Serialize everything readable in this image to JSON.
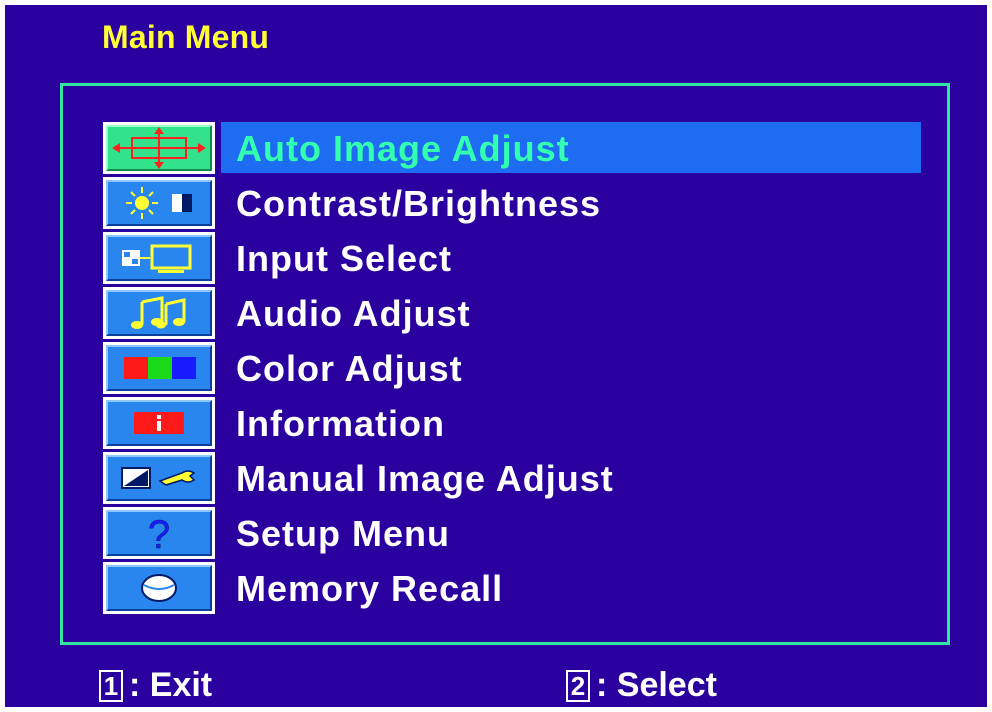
{
  "title": "Main Menu",
  "menu": {
    "items": [
      {
        "label": "Auto Image Adjust",
        "icon": "auto-adjust-icon",
        "selected": true
      },
      {
        "label": "Contrast/Brightness",
        "icon": "contrast-brightness-icon",
        "selected": false
      },
      {
        "label": "Input Select",
        "icon": "input-select-icon",
        "selected": false
      },
      {
        "label": "Audio Adjust",
        "icon": "audio-icon",
        "selected": false
      },
      {
        "label": "Color Adjust",
        "icon": "color-adjust-icon",
        "selected": false
      },
      {
        "label": "Information",
        "icon": "information-icon",
        "selected": false
      },
      {
        "label": "Manual Image Adjust",
        "icon": "manual-adjust-icon",
        "selected": false
      },
      {
        "label": "Setup Menu",
        "icon": "setup-menu-icon",
        "selected": false
      },
      {
        "label": "Memory Recall",
        "icon": "memory-recall-icon",
        "selected": false
      }
    ]
  },
  "footer": {
    "exit_key": "1",
    "exit_label": ": Exit",
    "select_key": "2",
    "select_label": ": Select"
  },
  "colors": {
    "background": "#2a009e",
    "title": "#ffff33",
    "frame": "#33e6a0",
    "highlight": "#1d6cf2",
    "selected_text": "#33ffb0"
  }
}
